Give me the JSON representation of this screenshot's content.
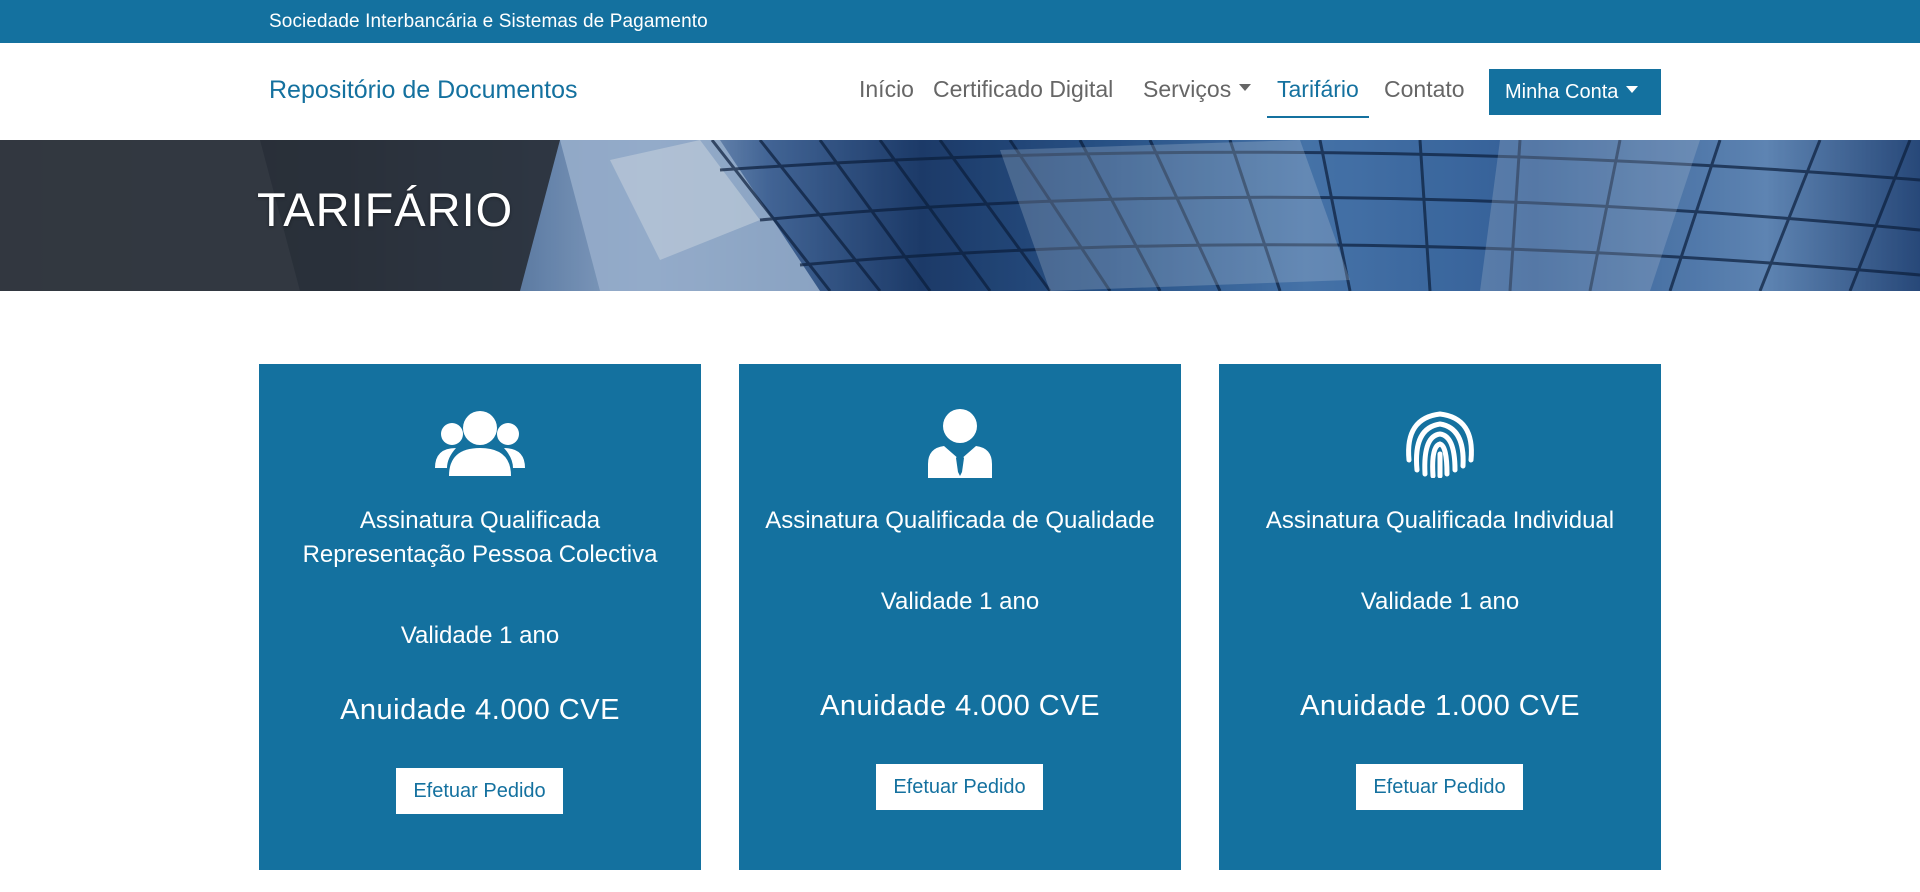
{
  "topbar": {
    "organization": "Sociedade Interbancária e Sistemas de Pagamento"
  },
  "navbar": {
    "brand": "Repositório de Documentos",
    "links": [
      {
        "label": "Início",
        "active": false
      },
      {
        "label": "Certificado Digital",
        "active": false
      },
      {
        "label": "Serviços",
        "active": false,
        "dropdown": true
      },
      {
        "label": "Tarifário",
        "active": true
      },
      {
        "label": "Contato",
        "active": false
      }
    ],
    "account_button": "Minha Conta"
  },
  "hero": {
    "title": "TARIFÁRIO"
  },
  "cards": [
    {
      "icon": "users-group-icon",
      "title": "Assinatura Qualificada Representação Pessoa Colectiva",
      "validity": "Validade 1 ano",
      "price": "Anuidade 4.000 CVE",
      "button": "Efetuar Pedido"
    },
    {
      "icon": "user-tie-icon",
      "title": "Assinatura Qualificada de Qualidade",
      "validity": "Validade 1 ano",
      "price": "Anuidade 4.000 CVE",
      "button": "Efetuar Pedido"
    },
    {
      "icon": "fingerprint-icon",
      "title": "Assinatura Qualificada Individual",
      "validity": "Validade 1 ano",
      "price": "Anuidade 1.000 CVE",
      "button": "Efetuar Pedido"
    }
  ],
  "colors": {
    "primary": "#14719f",
    "text_muted": "#666666",
    "white": "#ffffff"
  }
}
